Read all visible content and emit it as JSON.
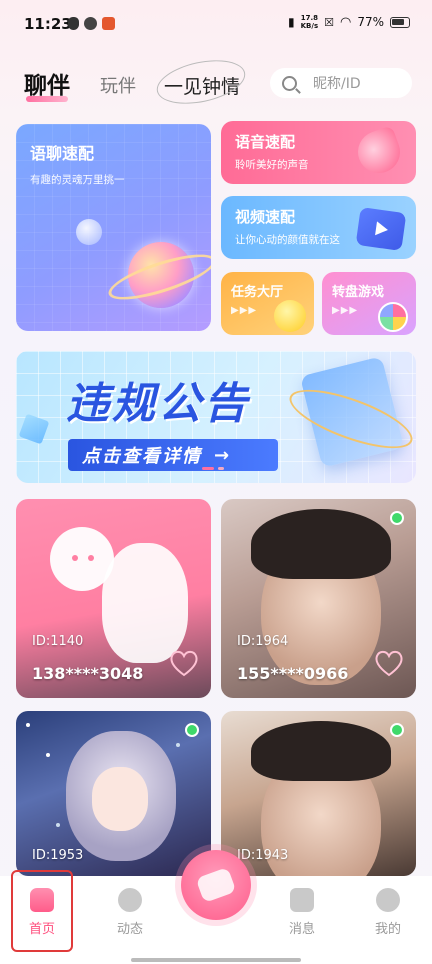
{
  "status_bar": {
    "time": "11:23",
    "net_speed": "17.8",
    "net_unit": "KB/s",
    "battery": "77%"
  },
  "tabs": {
    "active": "聊伴",
    "second": "玩伴",
    "third": "一见钟情"
  },
  "search": {
    "placeholder": "昵称/ID"
  },
  "feature_cards": {
    "voice_chat": {
      "title": "语聊速配",
      "subtitle": "有趣的灵魂万里挑一"
    },
    "voice_match": {
      "title": "语音速配",
      "subtitle": "聆听美好的声音"
    },
    "video_match": {
      "title": "视频速配",
      "subtitle": "让你心动的颜值就在这"
    },
    "tasks": {
      "title": "任务大厅",
      "arrows": "▶▶▶"
    },
    "wheel_game": {
      "title": "转盘游戏",
      "arrows": "▶▶▶"
    }
  },
  "banner": {
    "title": "违规公告",
    "button": "点击查看详情",
    "arrow": "→"
  },
  "users": [
    {
      "id_label": "ID:1140",
      "phone": "138****3048",
      "online": false
    },
    {
      "id_label": "ID:1964",
      "phone": "155****0966",
      "online": true
    },
    {
      "id_label": "ID:1953",
      "phone": "",
      "online": true
    },
    {
      "id_label": "ID:1943",
      "phone": "",
      "online": true
    }
  ],
  "bottom_nav": {
    "home": "首页",
    "moments": "动态",
    "messages": "消息",
    "mine": "我的"
  },
  "colors": {
    "accent": "#ff5c8a",
    "online": "#3fd96a",
    "highlight_box": "#e03a3a"
  },
  "icons": {
    "search": "search-icon",
    "home": "home-icon",
    "moments": "planet-icon",
    "center": "handshake-heart-icon",
    "messages": "lightning-icon",
    "mine": "profile-icon",
    "like": "heart-icon"
  }
}
